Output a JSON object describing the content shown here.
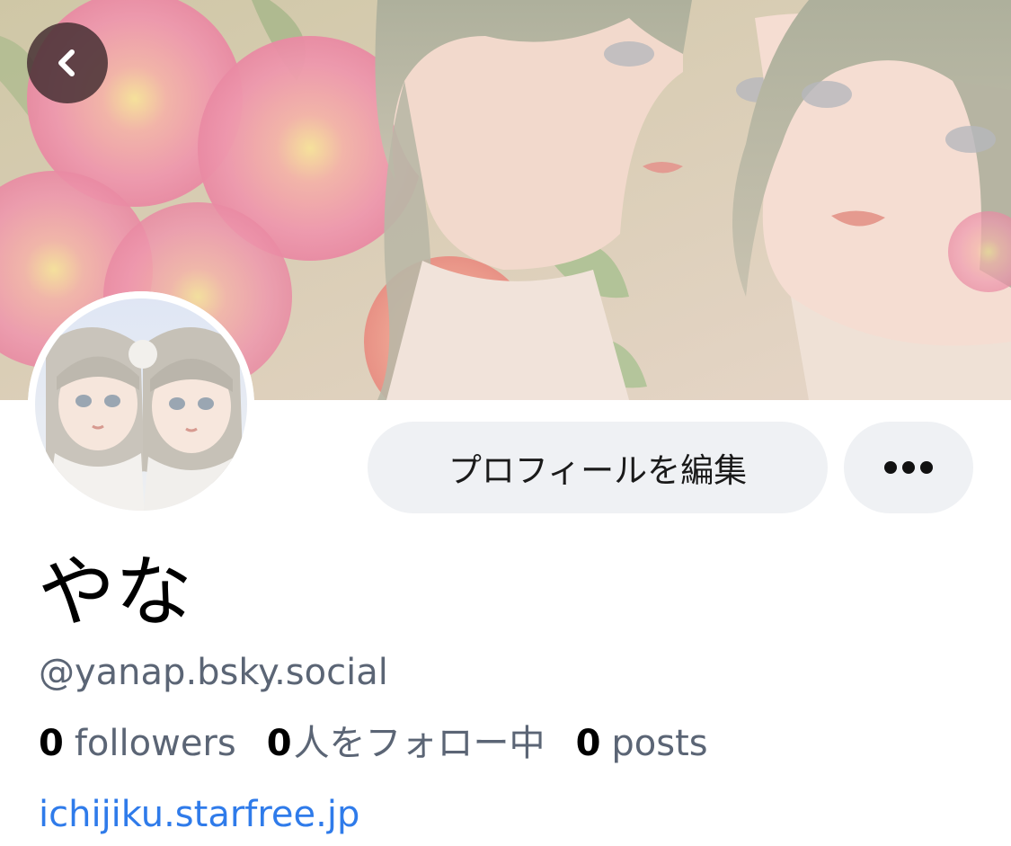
{
  "header": {
    "back_button_icon": "chevron-left-icon",
    "banner_image": "watercolor illustration banner"
  },
  "profile": {
    "avatar_image": "watercolor avatar illustration",
    "display_name": "やな",
    "handle": "@yanap.bsky.social",
    "website": "ichijiku.starfree.jp"
  },
  "actions": {
    "edit_profile_label": "プロフィールを編集",
    "more_icon": "ellipsis-icon"
  },
  "stats": {
    "followers_count": "0",
    "followers_label": "followers",
    "following_count": "0",
    "following_label": "人をフォロー中",
    "posts_count": "0",
    "posts_label": "posts"
  },
  "colors": {
    "link": "#2f7bea",
    "button_bg": "#eff1f4",
    "muted_text": "#5b6575",
    "back_button_bg": "#463034"
  }
}
